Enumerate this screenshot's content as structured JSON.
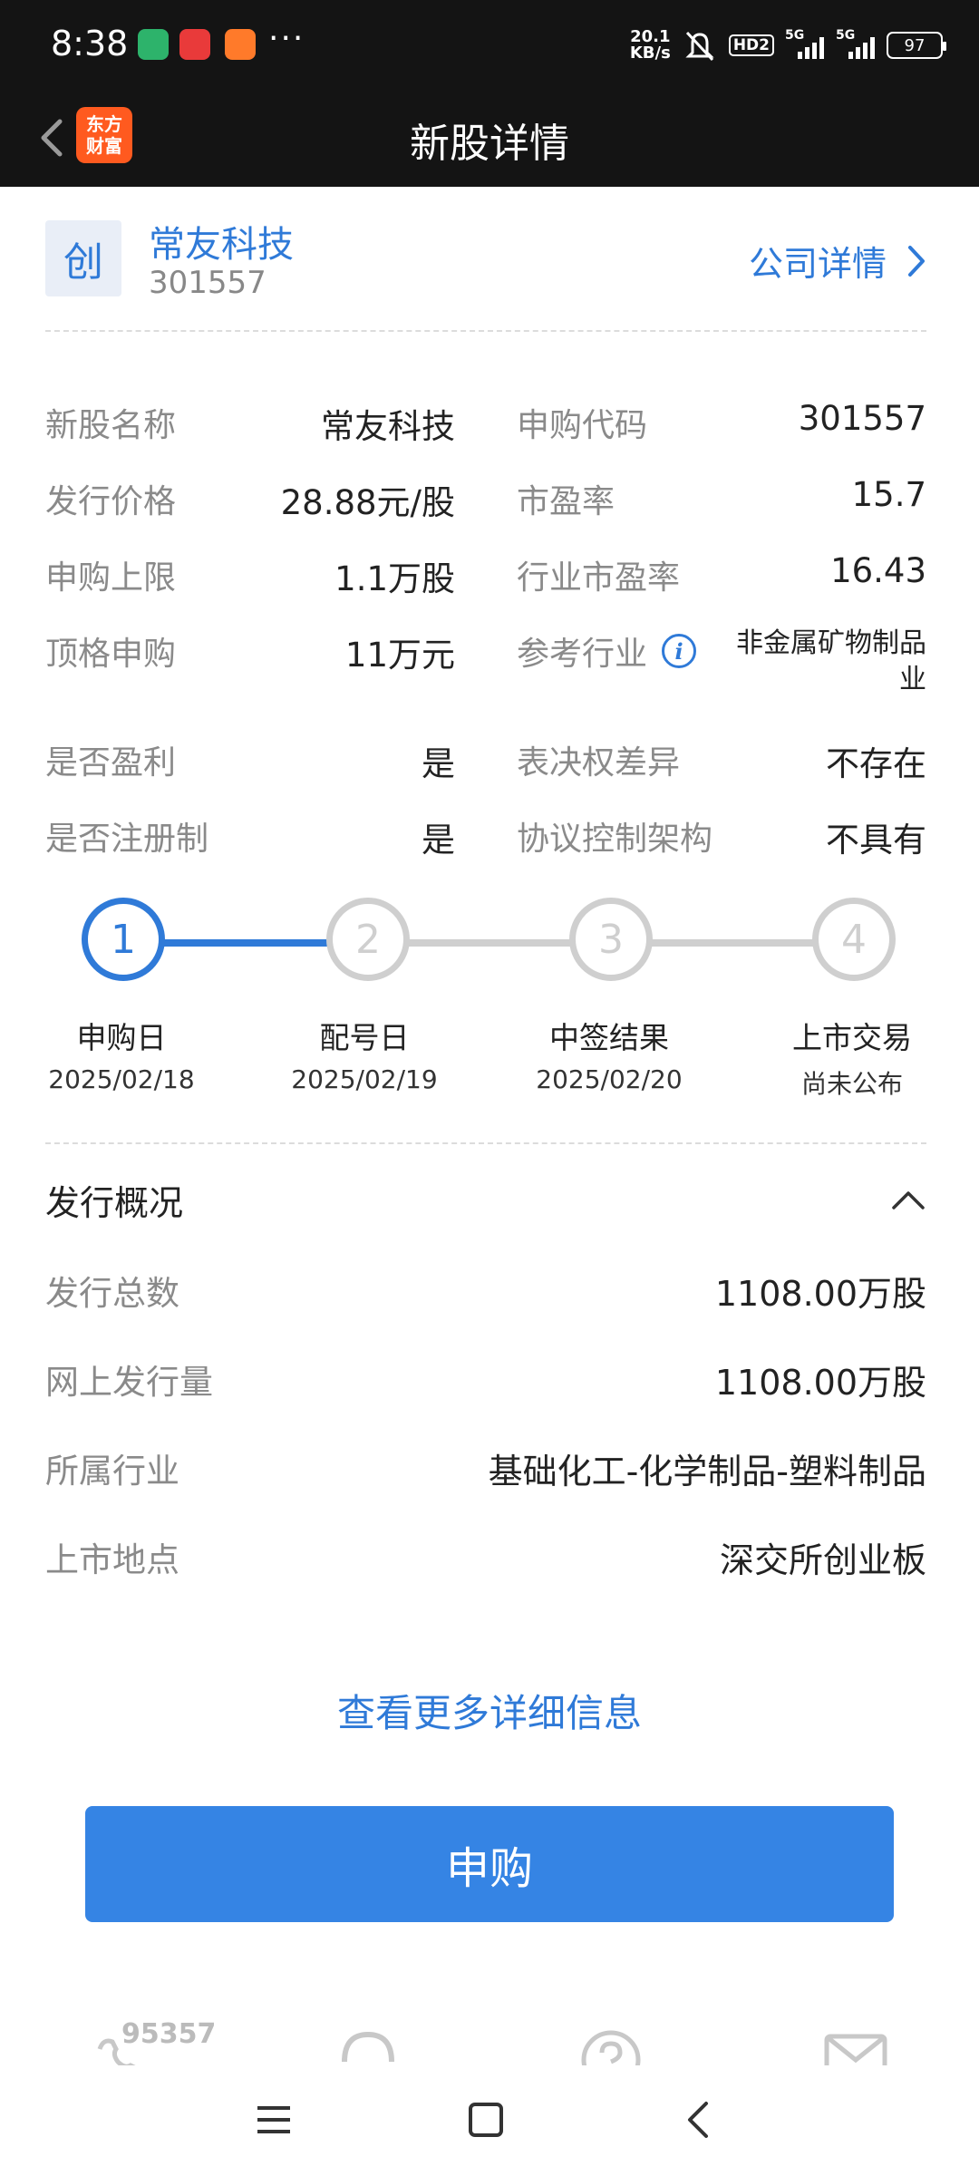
{
  "status_bar": {
    "time": "8:38",
    "more": "···",
    "net_speed_value": "20.1",
    "net_speed_unit": "KB/s",
    "hd": "HD2",
    "sim1": "5G",
    "sim2": "5G",
    "battery": "97"
  },
  "header": {
    "title": "新股详情",
    "logo_line1": "东方",
    "logo_line2": "财富"
  },
  "stock": {
    "board": "创",
    "name": "常友科技",
    "code": "301557",
    "company_link": "公司详情"
  },
  "info": [
    [
      {
        "label": "新股名称",
        "value": "常友科技"
      },
      {
        "label": "申购代码",
        "value": "301557"
      }
    ],
    [
      {
        "label": "发行价格",
        "value": "28.88元/股"
      },
      {
        "label": "市盈率",
        "value": "15.7"
      }
    ],
    [
      {
        "label": "申购上限",
        "value": "1.1万股"
      },
      {
        "label": "行业市盈率",
        "value": "16.43"
      }
    ],
    [
      {
        "label": "顶格申购",
        "value": "11万元"
      },
      {
        "label": "参考行业",
        "value": "非金属矿物制品业"
      }
    ],
    [
      {
        "label": "是否盈利",
        "value": "是"
      },
      {
        "label": "表决权差异",
        "value": "不存在"
      }
    ],
    [
      {
        "label": "是否注册制",
        "value": "是"
      },
      {
        "label": "协议控制架构",
        "value": "不具有"
      }
    ]
  ],
  "steps": [
    {
      "num": "1",
      "label": "申购日",
      "date": "2025/02/18",
      "active": true
    },
    {
      "num": "2",
      "label": "配号日",
      "date": "2025/02/19",
      "active": false
    },
    {
      "num": "3",
      "label": "中签结果",
      "date": "2025/02/20",
      "active": false
    },
    {
      "num": "4",
      "label": "上市交易",
      "date": "尚未公布",
      "active": false
    }
  ],
  "overview": {
    "title": "发行概况",
    "rows": [
      {
        "label": "发行总数",
        "value": "1108.00万股"
      },
      {
        "label": "网上发行量",
        "value": "1108.00万股"
      },
      {
        "label": "所属行业",
        "value": "基础化工-化学制品-塑料制品"
      },
      {
        "label": "上市地点",
        "value": "深交所创业板"
      }
    ]
  },
  "more_link": "查看更多详细信息",
  "subscribe_button": "申购",
  "toolbar": {
    "hotline": "95357"
  },
  "colors": {
    "accent": "#2f7ad8",
    "button": "#3584e4",
    "header_bg": "#141414",
    "step_inactive": "#cfcfcf"
  }
}
